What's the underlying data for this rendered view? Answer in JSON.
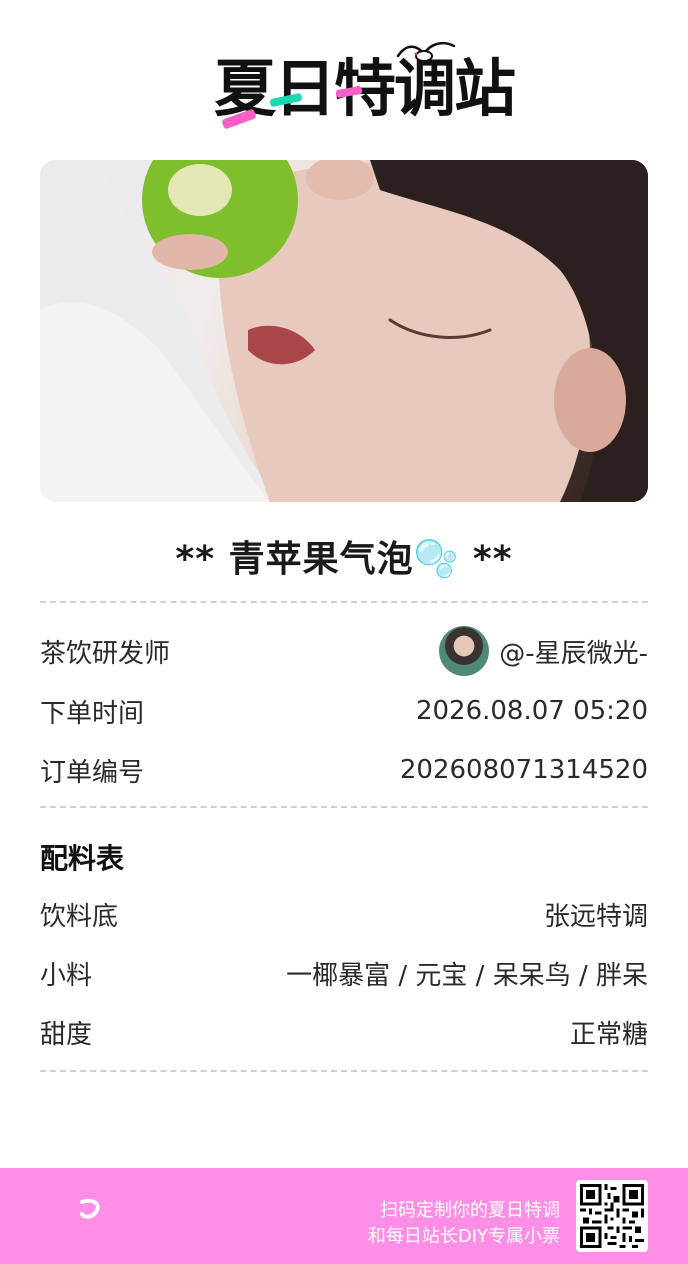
{
  "header": {
    "logo_text": "夏日特调站"
  },
  "ticket": {
    "title": "** 青苹果气泡🫧 **",
    "rows": [
      {
        "label": "茶饮研发师",
        "value": "@-星辰微光-"
      },
      {
        "label": "下单时间",
        "value": "2026.08.07  05:20"
      },
      {
        "label": "订单编号",
        "value": "202608071314520"
      }
    ],
    "recipe": {
      "heading": "配料表",
      "rows": [
        {
          "label": "饮料底",
          "value": "张远特调"
        },
        {
          "label": "小料",
          "value": "一椰暴富 / 元宝 / 呆呆鸟 / 胖呆"
        },
        {
          "label": "甜度",
          "value": "正常糖"
        }
      ]
    }
  },
  "footer": {
    "line1": "扫码定制你的夏日特调",
    "line2": "和每日站长DIY专属小票",
    "qr_icon": "qr-code-icon"
  },
  "colors": {
    "footer_bg": "#ff8fe6",
    "accent_pink": "#ff5dc8",
    "accent_teal": "#1ad8b0"
  }
}
